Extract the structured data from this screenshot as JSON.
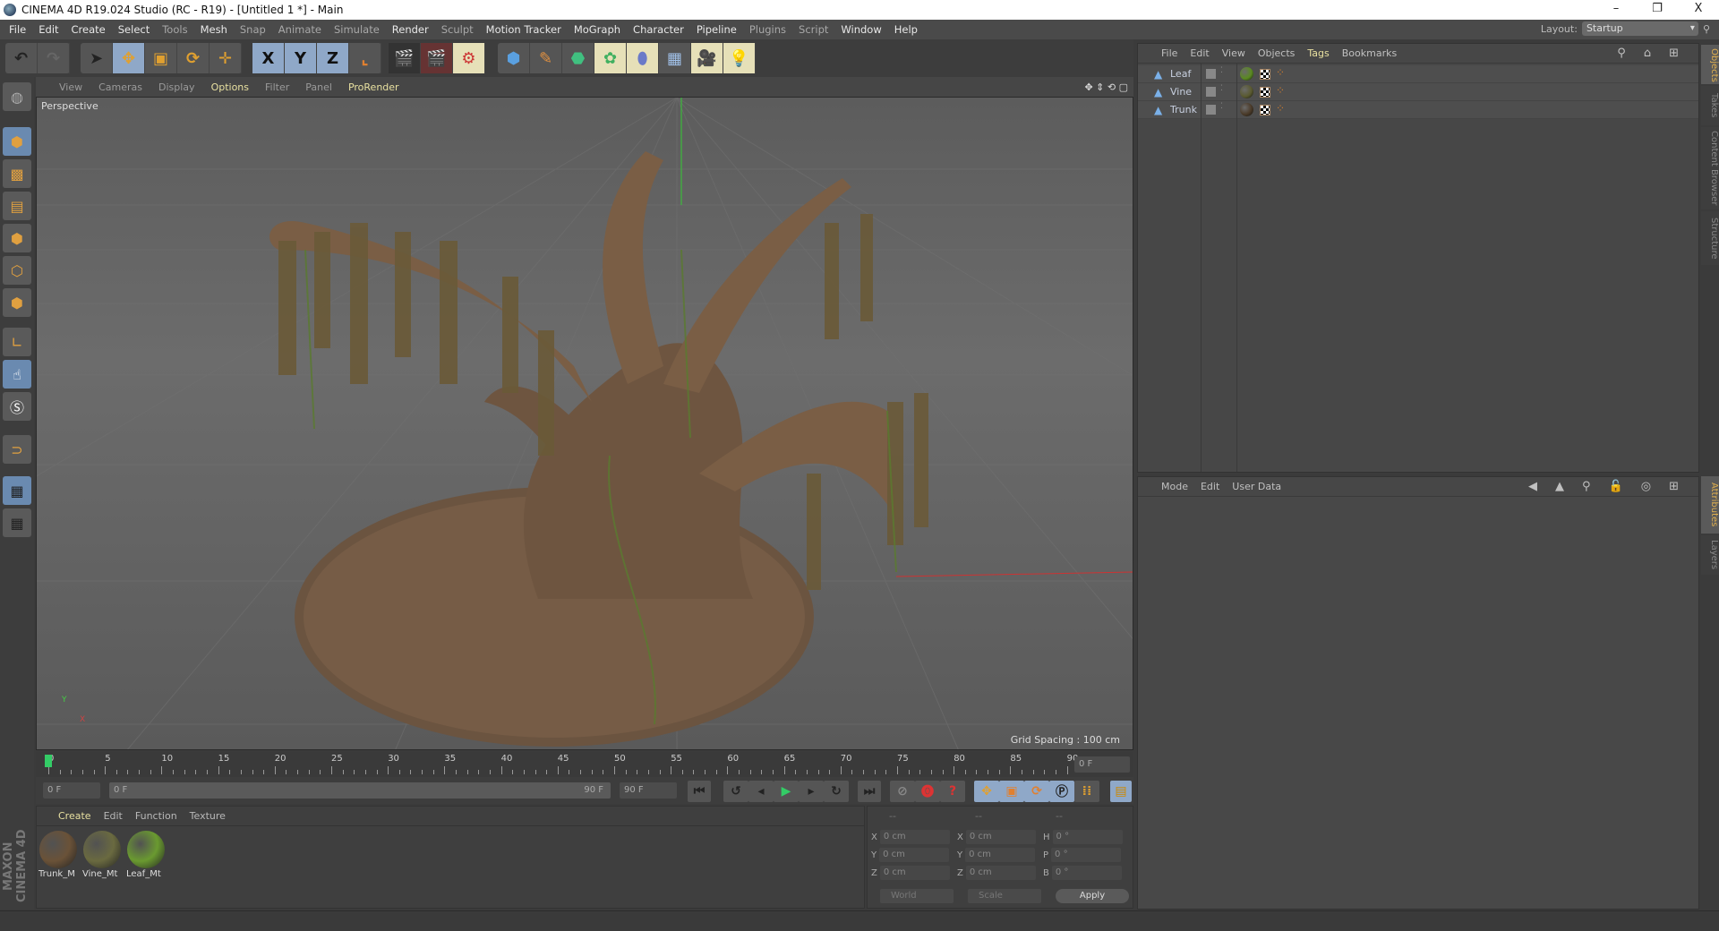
{
  "window": {
    "title": "CINEMA 4D R19.024 Studio (RC - R19) - [Untitled 1 *] - Main",
    "minimize": "–",
    "restore": "❐",
    "close": "X"
  },
  "menu": [
    "File",
    "Edit",
    "Create",
    "Select",
    "Tools",
    "Mesh",
    "Snap",
    "Animate",
    "Simulate",
    "Render",
    "Sculpt",
    "Motion Tracker",
    "MoGraph",
    "Character",
    "Pipeline",
    "Plugins",
    "Script",
    "Window",
    "Help"
  ],
  "layout": {
    "label": "Layout:",
    "value": "Startup"
  },
  "toolbar": {
    "x": "X",
    "y": "Y",
    "z": "Z"
  },
  "viewport": {
    "menu": [
      "View",
      "Cameras",
      "Display",
      "Options",
      "Filter",
      "Panel",
      "ProRender"
    ],
    "camera": "Perspective",
    "grid_spacing": "Grid Spacing : 100 cm",
    "axis_y": "Y",
    "axis_x": "X"
  },
  "timeline": {
    "ticks": [
      "0",
      "5",
      "10",
      "15",
      "20",
      "25",
      "30",
      "35",
      "40",
      "45",
      "50",
      "55",
      "60",
      "65",
      "70",
      "75",
      "80",
      "85",
      "90"
    ],
    "current_frame": "0 F",
    "start": "0 F",
    "range_start": "0 F",
    "range_end": "90 F",
    "end": "90 F",
    "playhead_frame": 0
  },
  "material_manager": {
    "menu": [
      "Create",
      "Edit",
      "Function",
      "Texture"
    ],
    "materials": [
      {
        "name": "Trunk_M",
        "color": "#6a5238"
      },
      {
        "name": "Vine_Mt",
        "color": "#6a6a40"
      },
      {
        "name": "Leaf_Mt",
        "color": "#6a9a30"
      }
    ]
  },
  "coordinates": {
    "headers": [
      "--",
      "--",
      "--"
    ],
    "rows": [
      {
        "a": "X",
        "av": "0 cm",
        "b": "X",
        "bv": "0 cm",
        "c": "H",
        "cv": "0 °"
      },
      {
        "a": "Y",
        "av": "0 cm",
        "b": "Y",
        "bv": "0 cm",
        "c": "P",
        "cv": "0 °"
      },
      {
        "a": "Z",
        "av": "0 cm",
        "b": "Z",
        "bv": "0 cm",
        "c": "B",
        "cv": "0 °"
      }
    ],
    "mode": "World",
    "scale": "Scale",
    "apply": "Apply"
  },
  "object_manager": {
    "menu": [
      "File",
      "Edit",
      "View",
      "Objects",
      "Tags",
      "Bookmarks"
    ],
    "objects": [
      {
        "name": "Leaf",
        "tag_color": "#5a8a20"
      },
      {
        "name": "Vine",
        "tag_color": "#5a5a30"
      },
      {
        "name": "Trunk",
        "tag_color": "#4a3a28"
      }
    ]
  },
  "attributes": {
    "menu": [
      "Mode",
      "Edit",
      "User Data"
    ]
  },
  "side_tabs": {
    "top": [
      "Objects",
      "Takes",
      "Content Browser",
      "Structure"
    ],
    "bottom": [
      "Attributes",
      "Layers"
    ]
  },
  "logo": "MAXON CINEMA 4D"
}
